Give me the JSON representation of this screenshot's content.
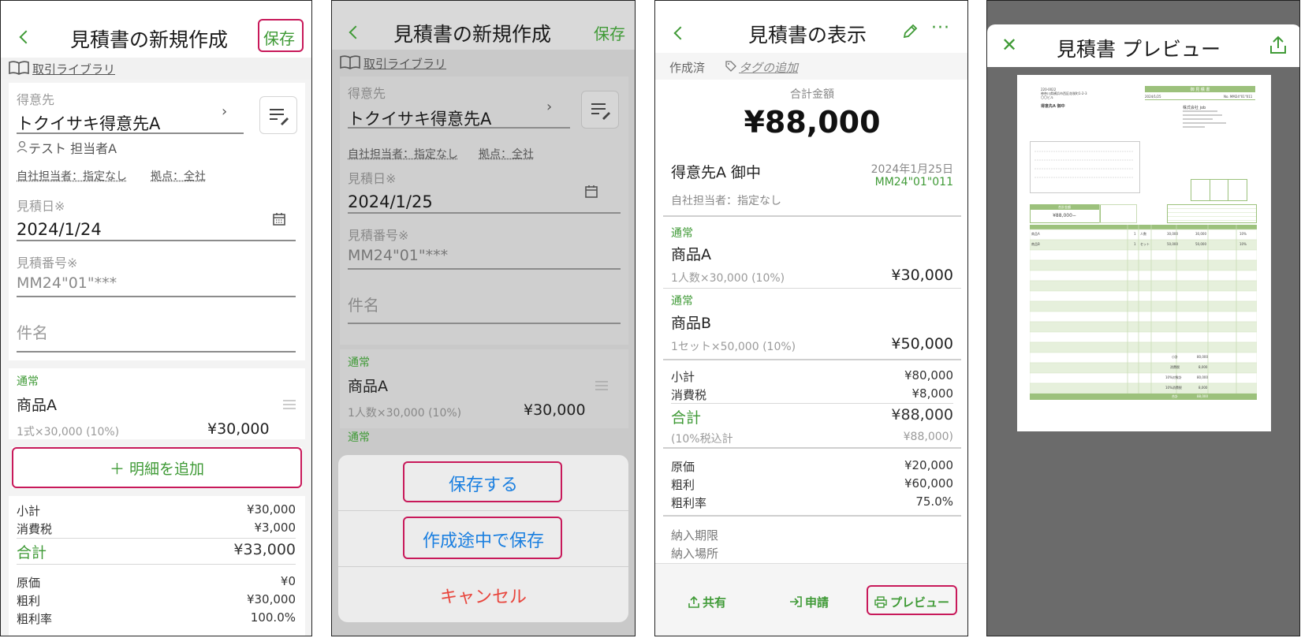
{
  "panel1": {
    "title": "見積書の新規作成",
    "save_label": "保存",
    "library_label": "取引ライブラリ",
    "customer_label": "得意先",
    "customer_value": "トクイサキ得意先A",
    "contact_value": "テスト 担当者A",
    "staff_text": "自社担当者：指定なし",
    "base_text": "拠点：全社",
    "date_label": "見積日※",
    "date_value": "2024/1/24",
    "number_label": "見積番号※",
    "number_value": "MM24\"01\"***",
    "subject_placeholder": "件名",
    "item_tag": "通常",
    "item_name": "商品A",
    "item_detail": "1式×30,000 (10%)",
    "item_amount": "¥30,000",
    "add_item_label": "＋ 明細を追加",
    "subtotal_label": "小計",
    "subtotal_value": "¥30,000",
    "tax_label": "消費税",
    "tax_value": "¥3,000",
    "total_label": "合計",
    "total_value": "¥33,000",
    "cost_label": "原価",
    "cost_value": "¥0",
    "profit_label": "粗利",
    "profit_value": "¥30,000",
    "margin_label": "粗利率",
    "margin_value": "100.0%"
  },
  "panel2": {
    "title": "見積書の新規作成",
    "save_label": "保存",
    "library_label": "取引ライブラリ",
    "customer_label": "得意先",
    "customer_value": "トクイサキ得意先A",
    "staff_text": "自社担当者：指定なし",
    "base_text": "拠点：全社",
    "date_label": "見積日※",
    "date_value": "2024/1/25",
    "number_label": "見積番号※",
    "number_value": "MM24\"01\"***",
    "subject_placeholder": "件名",
    "item_tag": "通常",
    "item_name": "商品A",
    "item_detail": "1人数×30,000 (10%)",
    "item_amount": "¥30,000",
    "item2_tag": "通常",
    "sheet": {
      "save_button": "保存する",
      "draft_button": "作成途中で保存",
      "cancel_button": "キャンセル"
    }
  },
  "panel3": {
    "title": "見積書の表示",
    "status_label": "作成済",
    "tag_label": "タグの追加",
    "total_caption": "合計金額",
    "total_big": "¥88,000",
    "customer": "得意先A 御中",
    "date": "2024年1月25日",
    "number": "MM24\"01\"011",
    "staff": "自社担当者：指定なし",
    "items": [
      {
        "tag": "通常",
        "name": "商品A",
        "detail": "1人数×30,000 (10%)",
        "amount": "¥30,000"
      },
      {
        "tag": "通常",
        "name": "商品B",
        "detail": "1セット×50,000 (10%)",
        "amount": "¥50,000"
      }
    ],
    "subtotal_label": "小計",
    "subtotal_value": "¥80,000",
    "tax_label": "消費税",
    "tax_value": "¥8,000",
    "total_label": "合計",
    "total_value": "¥88,000",
    "tax_incl_label": "(10%税込計",
    "tax_incl_value": "¥88,000)",
    "cost_label": "原価",
    "cost_value": "¥20,000",
    "profit_label": "粗利",
    "profit_value": "¥60,000",
    "margin_label": "粗利率",
    "margin_value": "75.0%",
    "deadline_label": "納入期限",
    "place_label": "納入場所",
    "share_label": "共有",
    "apply_label": "申請",
    "preview_label": "プレビュー"
  },
  "panel4": {
    "title": "見積書 プレビュー",
    "doc": {
      "zip": "220-0022",
      "address": "神奈川県横浜市西区花咲町1-2-3",
      "building": "〇〇ビル",
      "heading": "御 見 積 書",
      "date": "2024/1/25",
      "number": "No. MM24\"01\"011",
      "customer": "得意先A 御中",
      "company": "株式会社 job",
      "total_caption": "合計金額",
      "total_value": "¥88,000−",
      "row1_name": "商品A",
      "row1_qty": "1",
      "row1_unit": "人数",
      "row1_price": "30,000",
      "row1_amount": "30,000",
      "row1_tax": "10%",
      "row2_name": "商品B",
      "row2_qty": "1",
      "row2_unit": "セット",
      "row2_price": "50,000",
      "row2_amount": "50,000",
      "row2_tax": "10%",
      "sum1_label": "小計",
      "sum1_value": "80,000",
      "sum2_label": "消費税",
      "sum2_value": "8,000",
      "sum3_label": "10%対象計",
      "sum3_value": "80,000",
      "sum4_label": "10%消費税",
      "sum4_value": "8,000",
      "sum5_label": "合計",
      "sum5_value": "88,000"
    }
  },
  "colors": {
    "accent": "#3f9a36",
    "highlight": "#c8195a",
    "ios_blue": "#1a7fe0",
    "ios_red": "#e8453c"
  }
}
